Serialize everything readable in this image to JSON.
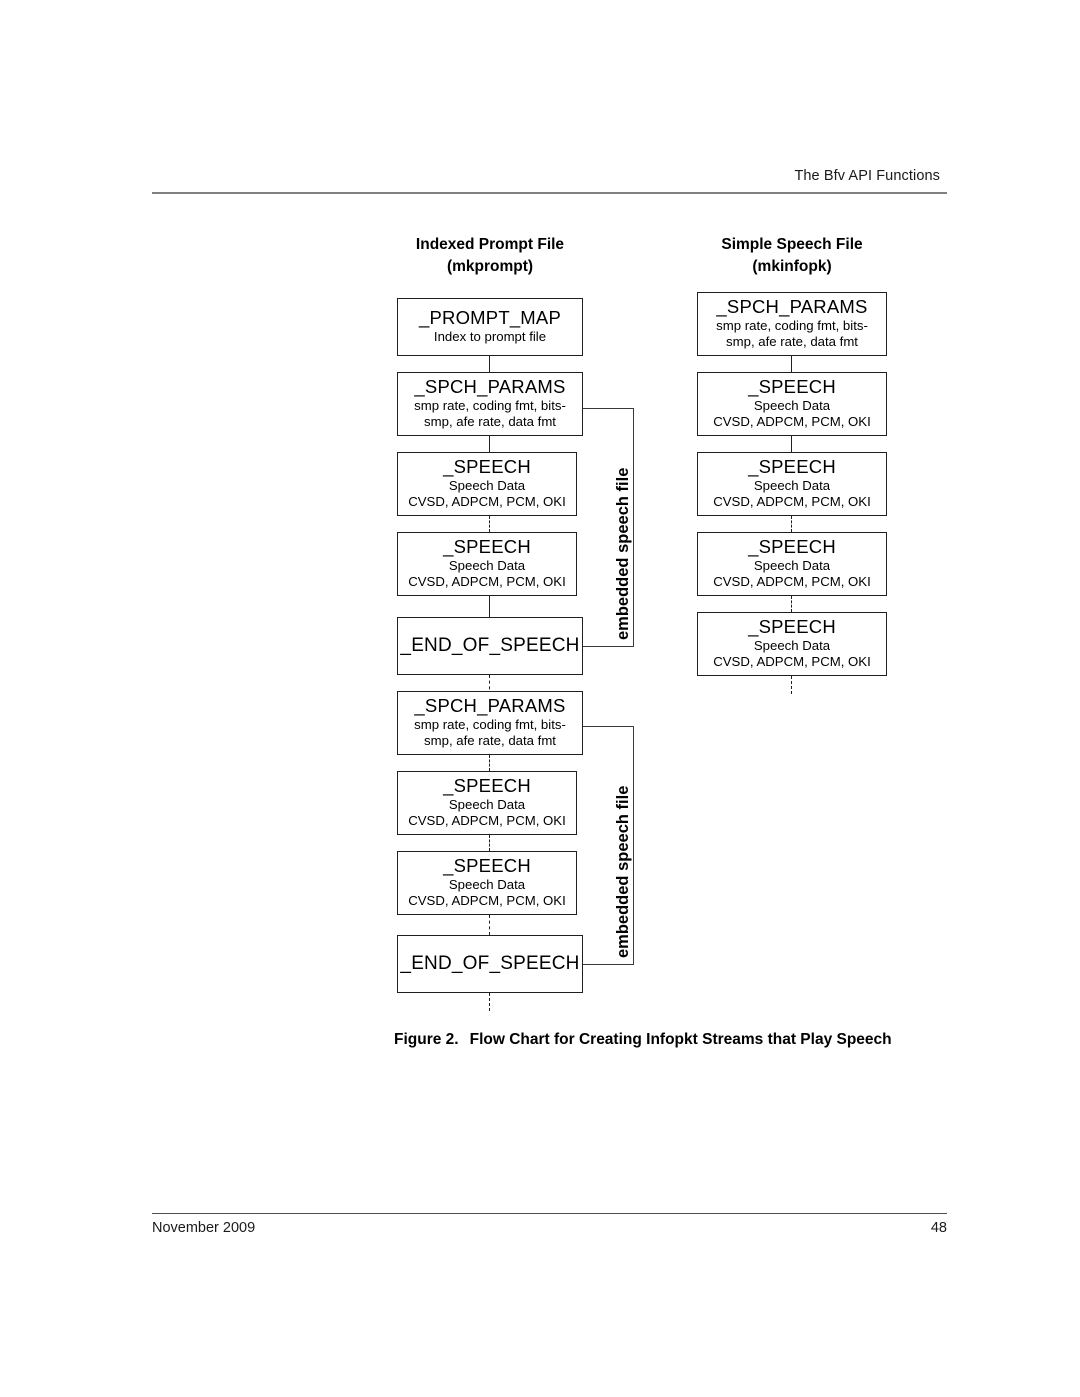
{
  "document": {
    "header_right": "The Bfv API Functions",
    "footer_left": "November 2009",
    "footer_page": "48"
  },
  "figure": {
    "caption_number": "Figure 2.",
    "caption_text": "Flow Chart for Creating Infopkt Streams that Play Speech",
    "bracket_label_1": "embedded speech file",
    "bracket_label_2": "embedded speech file"
  },
  "columns": [
    {
      "id": "indexed-prompt-file",
      "heading_line1": "Indexed Prompt File",
      "heading_line2": "(mkprompt)",
      "boxes": [
        {
          "title": "_PROMPT_MAP",
          "sub1": "Index to prompt file",
          "sub2": ""
        },
        {
          "title": "_SPCH_PARAMS",
          "sub1": "smp rate, coding fmt, bits-",
          "sub2": "smp, afe rate, data fmt"
        },
        {
          "title": "_SPEECH",
          "sub1": "Speech Data",
          "sub2": "CVSD, ADPCM, PCM, OKI"
        },
        {
          "title": "_SPEECH",
          "sub1": "Speech Data",
          "sub2": "CVSD, ADPCM, PCM, OKI"
        },
        {
          "title": "_END_OF_SPEECH",
          "sub1": "",
          "sub2": ""
        },
        {
          "title": "_SPCH_PARAMS",
          "sub1": "smp rate, coding fmt, bits-",
          "sub2": "smp, afe rate, data fmt"
        },
        {
          "title": "_SPEECH",
          "sub1": "Speech Data",
          "sub2": "CVSD, ADPCM, PCM, OKI"
        },
        {
          "title": "_SPEECH",
          "sub1": "Speech Data",
          "sub2": "CVSD, ADPCM, PCM, OKI"
        },
        {
          "title": "_END_OF_SPEECH",
          "sub1": "",
          "sub2": ""
        }
      ]
    },
    {
      "id": "simple-speech-file",
      "heading_line1": "Simple Speech File",
      "heading_line2": "(mkinfopk)",
      "boxes": [
        {
          "title": "_SPCH_PARAMS",
          "sub1": "smp rate, coding fmt, bits-",
          "sub2": "smp, afe rate, data fmt"
        },
        {
          "title": "_SPEECH",
          "sub1": "Speech Data",
          "sub2": "CVSD, ADPCM, PCM, OKI"
        },
        {
          "title": "_SPEECH",
          "sub1": "Speech Data",
          "sub2": "CVSD, ADPCM, PCM, OKI"
        },
        {
          "title": "_SPEECH",
          "sub1": "Speech Data",
          "sub2": "CVSD, ADPCM, PCM, OKI"
        },
        {
          "title": "_SPEECH",
          "sub1": "Speech Data",
          "sub2": "CVSD, ADPCM, PCM, OKI"
        }
      ]
    }
  ],
  "colors": {
    "ink": "#231f20",
    "rule": "#808080",
    "page_background": "#ffffff"
  }
}
